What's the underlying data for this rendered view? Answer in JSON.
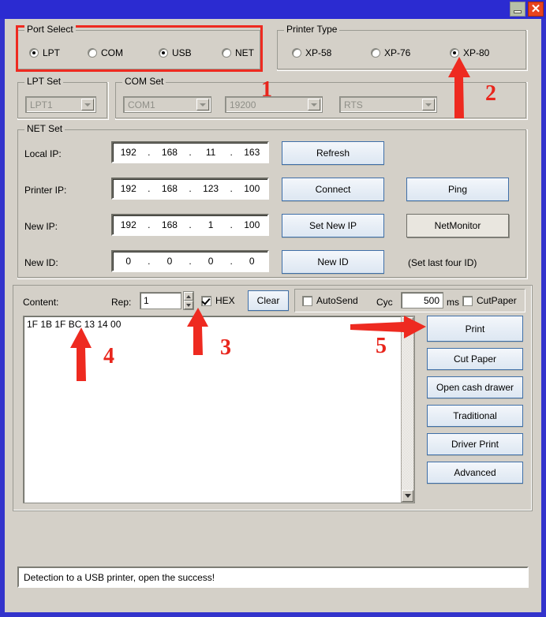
{
  "window": {
    "title": "",
    "minimize_label": "—",
    "close_label": "✕",
    "bg_color": "#d4d0c8",
    "title_color": "#2b2bd1"
  },
  "port_select": {
    "legend": "Port Select",
    "options": [
      {
        "label": "LPT",
        "selected": false
      },
      {
        "label": "COM",
        "selected": false
      },
      {
        "label": "USB",
        "selected": true
      },
      {
        "label": "NET",
        "selected": false
      }
    ]
  },
  "printer_type": {
    "legend": "Printer Type",
    "options": [
      {
        "label": "XP-58",
        "selected": false
      },
      {
        "label": "XP-76",
        "selected": false
      },
      {
        "label": "XP-80",
        "selected": true
      }
    ]
  },
  "lpt_set": {
    "legend": "LPT Set",
    "port": {
      "value": "LPT1",
      "enabled": false
    }
  },
  "com_set": {
    "legend": "COM Set",
    "port": {
      "value": "COM1",
      "enabled": false
    },
    "baud": {
      "value": "19200",
      "enabled": false
    },
    "flow": {
      "value": "RTS",
      "enabled": false
    }
  },
  "net_set": {
    "legend": "NET Set",
    "rows": [
      {
        "label": "Local IP:",
        "ip": [
          "192",
          "168",
          "11",
          "163"
        ],
        "button": "Refresh",
        "button2": null
      },
      {
        "label": "Printer IP:",
        "ip": [
          "192",
          "168",
          "123",
          "100"
        ],
        "button": "Connect",
        "button2": "Ping"
      },
      {
        "label": "New IP:",
        "ip": [
          "192",
          "168",
          "1",
          "100"
        ],
        "button": "Set New IP",
        "button2": "NetMonitor"
      },
      {
        "label": "New ID:",
        "ip": [
          "0",
          "0",
          "0",
          "0"
        ],
        "button": "New ID",
        "button2": null
      }
    ],
    "hint": "(Set last four ID)"
  },
  "content_panel": {
    "content_label": "Content:",
    "rep_label": "Rep:",
    "rep_value": "1",
    "hex_label": "HEX",
    "hex_checked": true,
    "clear_label": "Clear",
    "autosend_label": "AutoSend",
    "autosend_checked": false,
    "cyc_label": "Cyc",
    "cyc_value": "500",
    "ms_label": "ms",
    "cutpaper_label": "CutPaper",
    "cutpaper_checked": false,
    "text": "1F 1B 1F BC 13 14 00"
  },
  "action_buttons": [
    {
      "label": "Print"
    },
    {
      "label": "Cut Paper"
    },
    {
      "label": "Open cash drawer"
    },
    {
      "label": "Traditional"
    },
    {
      "label": "Driver Print"
    },
    {
      "label": "Advanced"
    }
  ],
  "status_bar": {
    "message": "Detection to a USB printer, open the success!"
  },
  "annotations": {
    "color": "#ee2a20",
    "numbers": [
      {
        "id": "1",
        "text": "1"
      },
      {
        "id": "2",
        "text": "2"
      },
      {
        "id": "3",
        "text": "3"
      },
      {
        "id": "4",
        "text": "4"
      },
      {
        "id": "5",
        "text": "5"
      }
    ]
  }
}
